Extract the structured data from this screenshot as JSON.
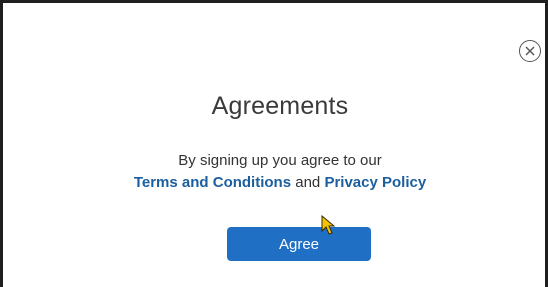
{
  "dialog": {
    "title": "Agreements",
    "message": "By signing up you agree to our",
    "terms_link": "Terms and Conditions",
    "conjunction": "and",
    "privacy_link": "Privacy Policy",
    "agree_label": "Agree",
    "close_icon": "close-circle-icon"
  },
  "colors": {
    "link": "#1b5f9e",
    "button": "#1f6fc5",
    "cursor": "#f2c300"
  }
}
